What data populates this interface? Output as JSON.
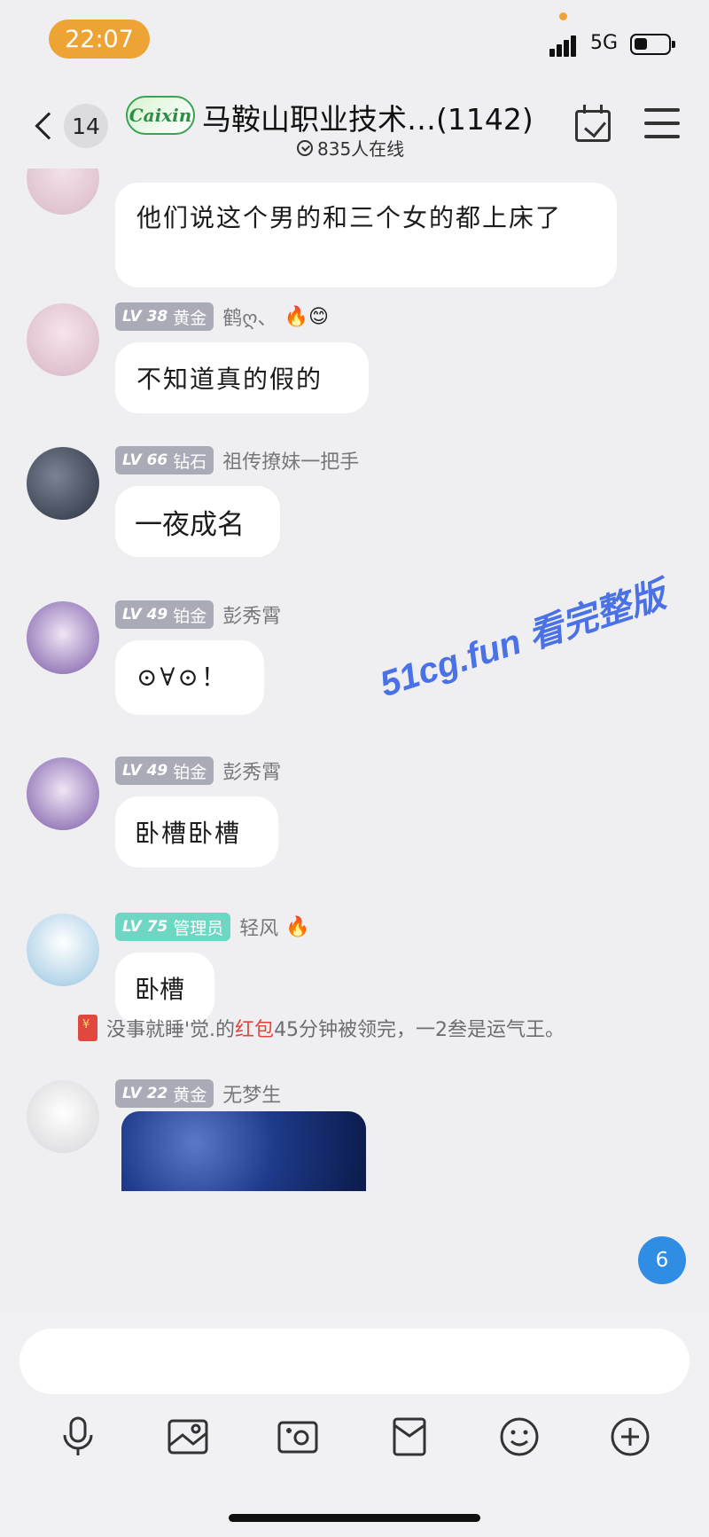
{
  "status_bar": {
    "time": "22:07",
    "network": "5G"
  },
  "header": {
    "back_count": "14",
    "logo_text": "Caixin",
    "group_title": "马鞍山职业技术…(1142)",
    "online_text": "835人在线"
  },
  "messages": [
    {
      "text": "他们说这个男的和三个女的都上床了"
    },
    {
      "level": "LV 38",
      "rank": "黄金",
      "nickname": "鹤ღ、",
      "emoji": "🔥😊",
      "text": "不知道真的假的"
    },
    {
      "level": "LV 66",
      "rank": "钻石",
      "nickname": "祖传撩妹一把手",
      "text": "一夜成名"
    },
    {
      "level": "LV 49",
      "rank": "铂金",
      "nickname": "彭秀霄",
      "text": "⊙∀⊙！"
    },
    {
      "level": "LV 49",
      "rank": "铂金",
      "nickname": "彭秀霄",
      "text": "卧槽卧槽"
    },
    {
      "level": "LV 75",
      "rank": "管理员",
      "nickname": "轻风",
      "emoji": "🔥",
      "text": "卧槽"
    },
    {
      "level": "LV 22",
      "rank": "黄金",
      "nickname": "无梦生"
    }
  ],
  "system_notice": {
    "before": "没事就睡'觉.的",
    "highlight": "红包",
    "after": "45分钟被领完，一2叁是运气王。"
  },
  "watermark": "51cg.fun 看完整版",
  "unread_float": "6",
  "toolbar_icons": [
    "mic-icon",
    "image-icon",
    "camera-icon",
    "red-packet-icon",
    "emoji-icon",
    "plus-icon"
  ],
  "colors": {
    "time_pill": "#eea335",
    "admin_badge": "#6fd6c4",
    "level_badge": "#a9abb6",
    "watermark": "#4a72e6",
    "float_badge": "#2f8de4"
  }
}
